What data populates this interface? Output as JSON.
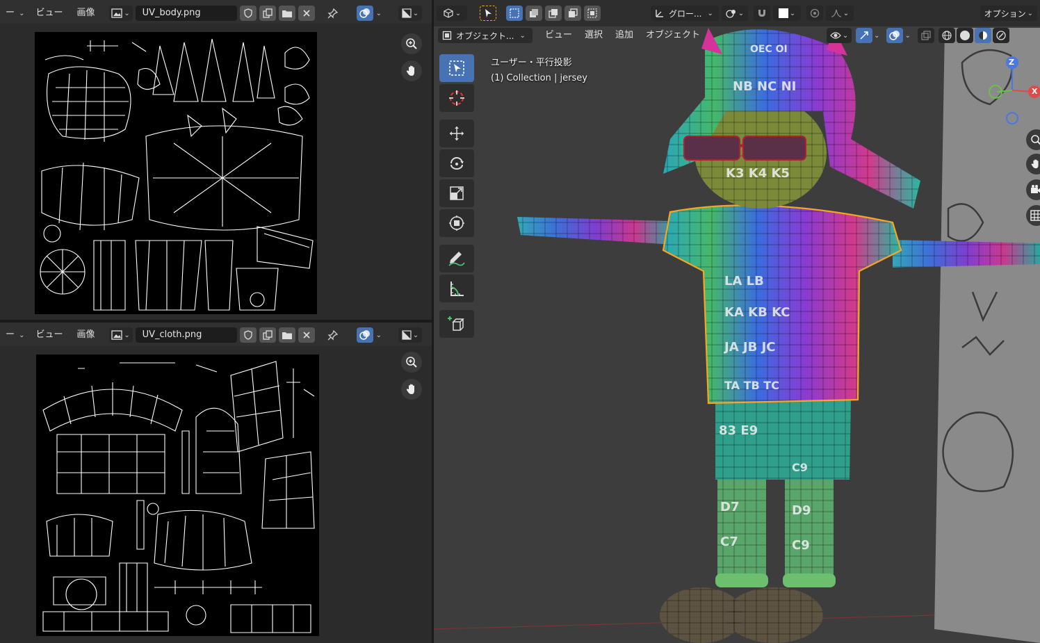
{
  "uv_top": {
    "menu_view": "ビュー",
    "menu_image": "画像",
    "image_name": "UV_body.png"
  },
  "uv_bottom": {
    "menu_view": "ビュー",
    "menu_image": "画像",
    "image_name": "UV_cloth.png"
  },
  "viewport": {
    "transform_orientation": "グロー...",
    "options_label": "オプション",
    "mode_label": "オブジェクト...",
    "menus": [
      "ビュー",
      "選択",
      "追加",
      "オブジェクト"
    ],
    "projection_label": "ユーザー・平行投影",
    "collection_label": "(1) Collection | jersey",
    "gizmo": {
      "z": "Z",
      "x": "X"
    }
  },
  "colors": {
    "header_bg": "#303030",
    "active_blue": "#4772b3",
    "selection_orange": "#f5a623",
    "viewport_bg": "#3d3d3d"
  }
}
